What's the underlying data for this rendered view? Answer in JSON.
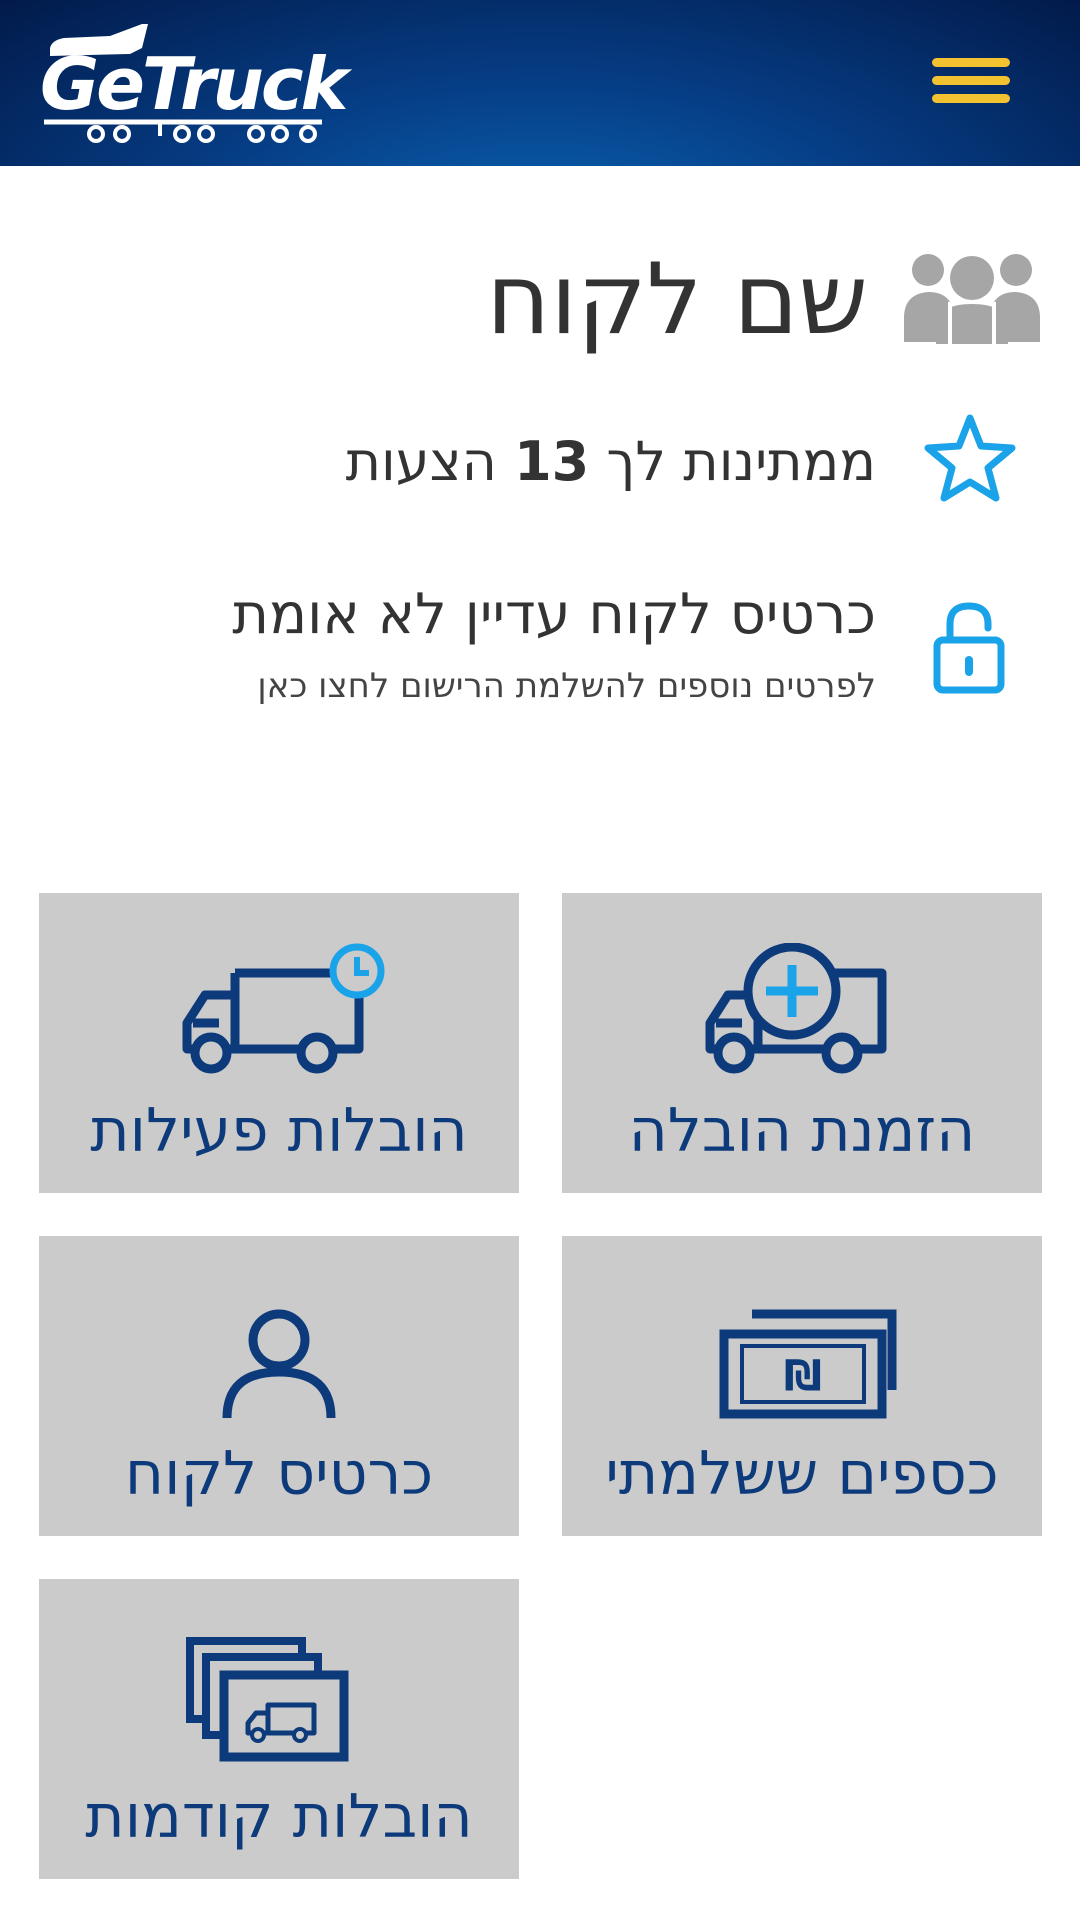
{
  "header": {
    "logo_text": "GeTruck",
    "menu_icon": "hamburger-menu-icon",
    "colors": {
      "bg": "#04296a",
      "menu": "#f2c230"
    }
  },
  "customer": {
    "name": "שם לקוח",
    "icon": "users-icon"
  },
  "offers": {
    "prefix": "ממתינות לך",
    "count": "13",
    "suffix": "הצעות",
    "icon": "star-icon"
  },
  "verification": {
    "title": "כרטיס לקוח עדיין לא אומת",
    "subtitle": "לפרטים נוספים להשלמת הרישום לחצו כאן",
    "icon": "lock-icon"
  },
  "tiles": [
    {
      "label": "הזמנת הובלה",
      "icon": "truck-plus-icon"
    },
    {
      "label": "הובלות פעילות",
      "icon": "truck-clock-icon"
    },
    {
      "label": "כספים ששלמתי",
      "icon": "shekel-bills-icon"
    },
    {
      "label": "כרטיס לקוח",
      "icon": "user-icon"
    },
    {
      "label": "הובלות קודמות",
      "icon": "truck-cards-stack-icon"
    }
  ],
  "colors": {
    "accent": "#1aa3e8",
    "tile_bg": "#cbcbcb",
    "tile_fg": "#0c3a7a",
    "text": "#333333"
  }
}
